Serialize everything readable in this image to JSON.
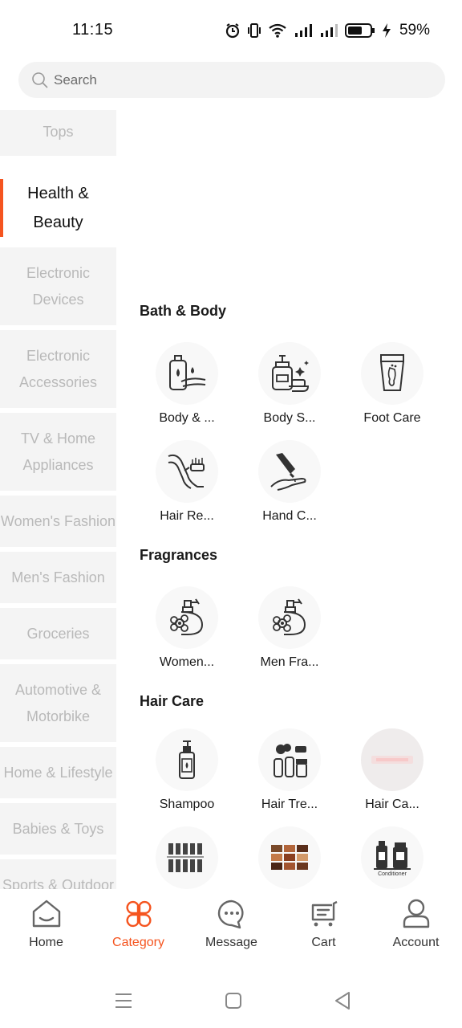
{
  "status_bar": {
    "time": "11:15",
    "battery_percent": "59%"
  },
  "search": {
    "placeholder": "Search"
  },
  "sidebar": {
    "items": [
      {
        "label": "Tops"
      },
      {
        "label": "Health &\nBeauty"
      },
      {
        "label": "Electronic\nDevices"
      },
      {
        "label": "Electronic\nAccessories"
      },
      {
        "label": "TV & Home\nAppliances"
      },
      {
        "label": "Women's Fashion"
      },
      {
        "label": "Men's Fashion"
      },
      {
        "label": "Groceries"
      },
      {
        "label": "Automotive &\nMotorbike"
      },
      {
        "label": "Home & Lifestyle"
      },
      {
        "label": "Babies & Toys"
      },
      {
        "label": "Sports & Outdoor"
      }
    ],
    "active_index": 1
  },
  "content": {
    "sections": [
      {
        "title": "Bath & Body",
        "items": [
          {
            "label": "Body & ...",
            "icon": "body-wash-icon"
          },
          {
            "label": "Body S...",
            "icon": "body-soap-icon"
          },
          {
            "label": "Foot Care",
            "icon": "foot-care-icon"
          },
          {
            "label": "Hair Re...",
            "icon": "hair-removal-icon"
          },
          {
            "label": "Hand C...",
            "icon": "hand-cream-icon"
          }
        ]
      },
      {
        "title": "Fragrances",
        "items": [
          {
            "label": "Women...",
            "icon": "perfume-icon"
          },
          {
            "label": "Men Fra...",
            "icon": "perfume-icon"
          }
        ]
      },
      {
        "title": "Hair Care",
        "items": [
          {
            "label": "Shampoo",
            "icon": "shampoo-icon"
          },
          {
            "label": "Hair Tre...",
            "icon": "hair-treatment-icon"
          },
          {
            "label": "Hair Ca...",
            "icon": "hair-care-image"
          },
          {
            "label": "",
            "icon": "hair-brushes-icon"
          },
          {
            "label": "",
            "icon": "hair-color-palette-icon"
          },
          {
            "label": "",
            "icon": "conditioner-icon",
            "caption": "Conditioner"
          }
        ]
      }
    ]
  },
  "bottom_nav": {
    "items": [
      {
        "label": "Home",
        "icon": "home-icon"
      },
      {
        "label": "Category",
        "icon": "category-icon"
      },
      {
        "label": "Message",
        "icon": "message-icon"
      },
      {
        "label": "Cart",
        "icon": "cart-icon"
      },
      {
        "label": "Account",
        "icon": "account-icon"
      }
    ],
    "active_index": 1
  },
  "colors": {
    "accent": "#f5541f",
    "sidebar_bg": "#f4f4f4",
    "sidebar_text": "#b9b9b9"
  }
}
